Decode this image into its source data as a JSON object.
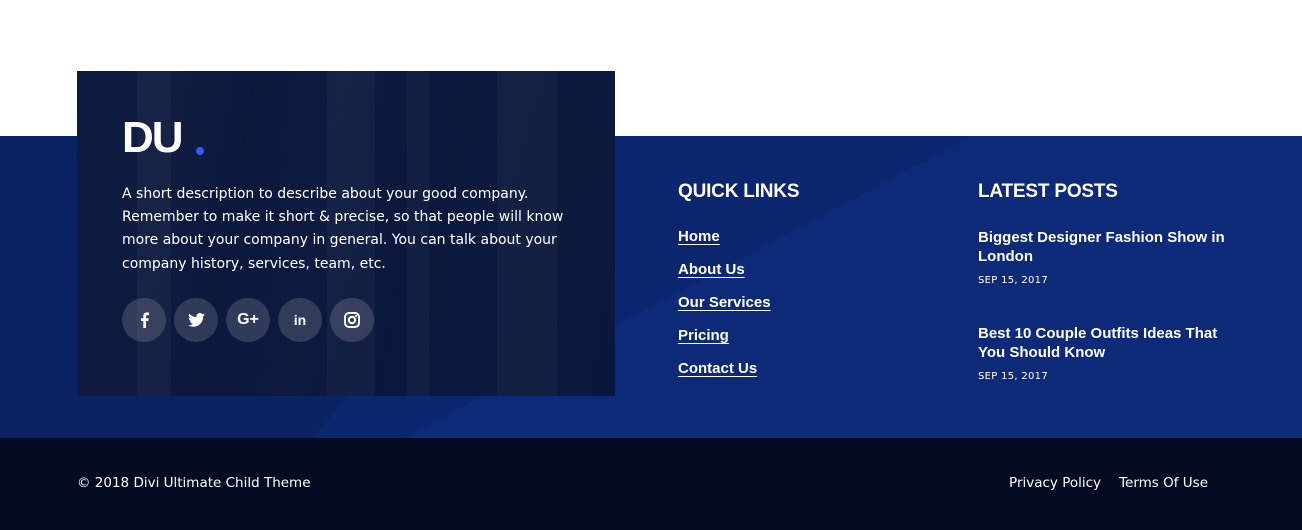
{
  "brand": {
    "logo_text": "DU",
    "dot_color": "#2f5bff",
    "description": "A short description to describe about your good company. Remember to make it short & precise, so that people will know more about your company in general. You can talk about your company history, services, team, etc."
  },
  "social": [
    {
      "icon": "facebook-icon"
    },
    {
      "icon": "twitter-icon"
    },
    {
      "icon": "google-plus-icon",
      "glyph": "G+"
    },
    {
      "icon": "linkedin-icon",
      "glyph": "in"
    },
    {
      "icon": "instagram-icon"
    }
  ],
  "quick_links": {
    "title": "QUICK LINKS",
    "items": [
      {
        "label": "Home"
      },
      {
        "label": "About Us"
      },
      {
        "label": "Our Services"
      },
      {
        "label": "Pricing"
      },
      {
        "label": "Contact Us"
      }
    ]
  },
  "latest_posts": {
    "title": "LATEST POSTS",
    "items": [
      {
        "title": "Biggest Designer Fashion Show in London",
        "date": "SEP 15, 2017"
      },
      {
        "title": "Best 10 Couple Outfits Ideas That You Should Know",
        "date": "SEP 15, 2017"
      }
    ]
  },
  "bottom_bar": {
    "copyright": "© 2018 Divi Ultimate Child Theme",
    "links": [
      {
        "label": "Privacy Policy"
      },
      {
        "label": "Terms Of Use"
      }
    ]
  },
  "colors": {
    "main_band": "#0b2262",
    "bottom_bar": "#030a21",
    "card_overlay": "#0a163c",
    "accent": "#2f5bff"
  }
}
